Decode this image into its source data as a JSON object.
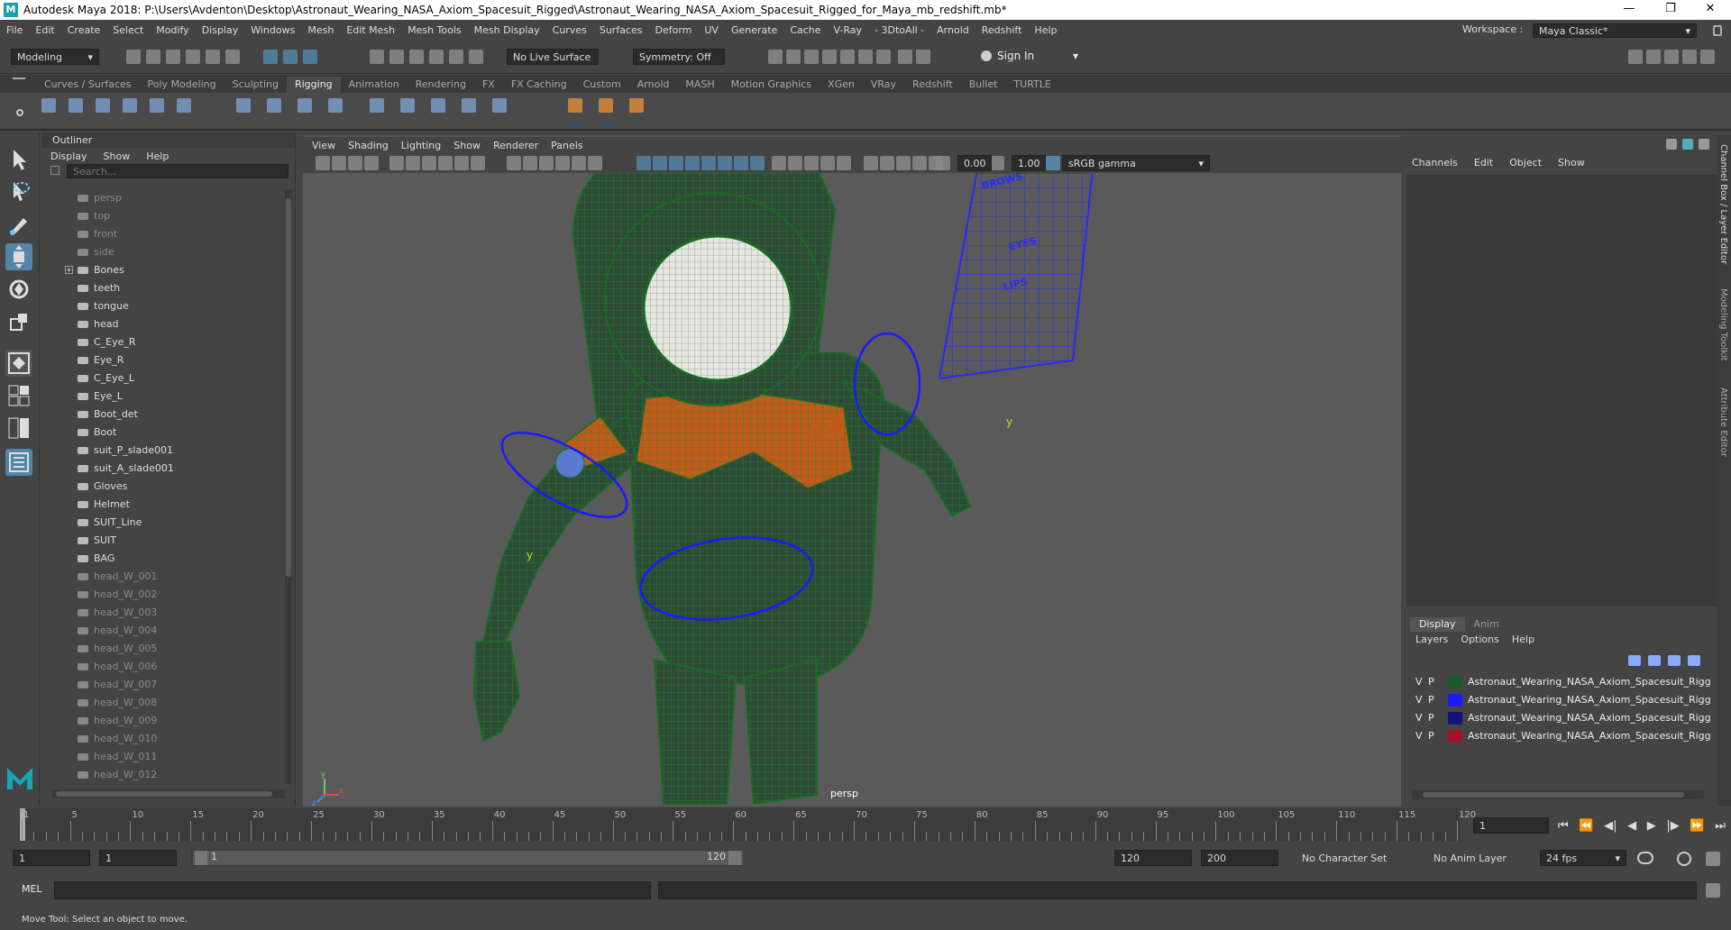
{
  "window": {
    "title": "Autodesk Maya 2018: P:\\Users\\Avdenton\\Desktop\\Astronaut_Wearing_NASA_Axiom_Spacesuit_Rigged\\Astronaut_Wearing_NASA_Axiom_Spacesuit_Rigged_for_Maya_mb_redshift.mb*",
    "logo": "M",
    "min": "—",
    "max": "❐",
    "close": "✕"
  },
  "menubar": [
    "File",
    "Edit",
    "Create",
    "Select",
    "Modify",
    "Display",
    "Windows",
    "Mesh",
    "Edit Mesh",
    "Mesh Tools",
    "Mesh Display",
    "Curves",
    "Surfaces",
    "Deform",
    "UV",
    "Generate",
    "Cache",
    "V-Ray",
    "- 3DtoAll -",
    "Arnold",
    "Redshift",
    "Help"
  ],
  "workspace": {
    "label": "Workspace :",
    "value": "Maya Classic*"
  },
  "statusline": {
    "mode": "Modeling",
    "live_surface": "No Live Surface",
    "symmetry": "Symmetry: Off",
    "sign_in": "Sign In"
  },
  "shelf_tabs": [
    "Curves / Surfaces",
    "Poly Modeling",
    "Sculpting",
    "Rigging",
    "Animation",
    "Rendering",
    "FX",
    "FX Caching",
    "Custom",
    "Arnold",
    "MASH",
    "Motion Graphics",
    "XGen",
    "VRay",
    "Redshift",
    "Bullet",
    "TURTLE"
  ],
  "shelf_active": "Rigging",
  "outliner": {
    "title": "Outliner",
    "menus": [
      "Display",
      "Show",
      "Help"
    ],
    "search_placeholder": "Search...",
    "items": [
      {
        "label": "persp",
        "dim": true
      },
      {
        "label": "top",
        "dim": true
      },
      {
        "label": "front",
        "dim": true
      },
      {
        "label": "side",
        "dim": true
      },
      {
        "label": "Bones",
        "dim": false
      },
      {
        "label": "teeth",
        "dim": false
      },
      {
        "label": "tongue",
        "dim": false
      },
      {
        "label": "head",
        "dim": false
      },
      {
        "label": "C_Eye_R",
        "dim": false
      },
      {
        "label": "Eye_R",
        "dim": false
      },
      {
        "label": "C_Eye_L",
        "dim": false
      },
      {
        "label": "Eye_L",
        "dim": false
      },
      {
        "label": "Boot_det",
        "dim": false
      },
      {
        "label": "Boot",
        "dim": false
      },
      {
        "label": "suit_P_slade001",
        "dim": false
      },
      {
        "label": "suit_A_slade001",
        "dim": false
      },
      {
        "label": "Gloves",
        "dim": false
      },
      {
        "label": "Helmet",
        "dim": false
      },
      {
        "label": "SUIT_Line",
        "dim": false
      },
      {
        "label": "SUIT",
        "dim": false
      },
      {
        "label": "BAG",
        "dim": false
      },
      {
        "label": "head_W_001",
        "dim": true
      },
      {
        "label": "head_W_002",
        "dim": true
      },
      {
        "label": "head_W_003",
        "dim": true
      },
      {
        "label": "head_W_004",
        "dim": true
      },
      {
        "label": "head_W_005",
        "dim": true
      },
      {
        "label": "head_W_006",
        "dim": true
      },
      {
        "label": "head_W_007",
        "dim": true
      },
      {
        "label": "head_W_008",
        "dim": true
      },
      {
        "label": "head_W_009",
        "dim": true
      },
      {
        "label": "head_W_010",
        "dim": true
      },
      {
        "label": "head_W_011",
        "dim": true
      },
      {
        "label": "head_W_012",
        "dim": true
      }
    ]
  },
  "viewport": {
    "menus": [
      "View",
      "Shading",
      "Lighting",
      "Show",
      "Renderer",
      "Panels"
    ],
    "near": "0.00",
    "far": "1.00",
    "colorspace": "sRGB gamma",
    "camera": "persp",
    "face_labels": [
      "BROWS",
      "EYES",
      "LIPS"
    ],
    "ax_logo": "AX",
    "axis_y": "y",
    "axis_x": "x",
    "axis_z": "z"
  },
  "channelbox": {
    "menus": [
      "Channels",
      "Edit",
      "Object",
      "Show"
    ]
  },
  "layers": {
    "tabs": [
      "Display",
      "Anim"
    ],
    "menus": [
      "Layers",
      "Options",
      "Help"
    ],
    "rows": [
      {
        "v": "V",
        "p": "P",
        "color": "#1a5a28",
        "name": "Astronaut_Wearing_NASA_Axiom_Spacesuit_Rigged_C"
      },
      {
        "v": "V",
        "p": "P",
        "color": "#1a1aff",
        "name": "Astronaut_Wearing_NASA_Axiom_Spacesuit_Rigged_C"
      },
      {
        "v": "V",
        "p": "P",
        "color": "#141480",
        "name": "Astronaut_Wearing_NASA_Axiom_Spacesuit_Rigged_H"
      },
      {
        "v": "V",
        "p": "P",
        "color": "#a01428",
        "name": "Astronaut_Wearing_NASA_Axiom_Spacesuit_Rigged_E"
      }
    ]
  },
  "right_tabs": [
    "Channel Box / Layer Editor",
    "Modeling Toolkit",
    "Attribute Editor"
  ],
  "timeline": {
    "ticks": [
      "1",
      "5",
      "10",
      "15",
      "20",
      "25",
      "30",
      "35",
      "40",
      "45",
      "50",
      "55",
      "60",
      "65",
      "70",
      "75",
      "80",
      "85",
      "90",
      "95",
      "100",
      "105",
      "110",
      "115",
      "120"
    ],
    "current": "1"
  },
  "range": {
    "start": "1",
    "start2": "1",
    "slider_start": "1",
    "slider_end": "120",
    "end": "120",
    "end2": "200",
    "character_set": "No Character Set",
    "anim_layer": "No Anim Layer",
    "fps": "24 fps"
  },
  "mel": {
    "label": "MEL"
  },
  "help": "Move Tool: Select an object to move."
}
